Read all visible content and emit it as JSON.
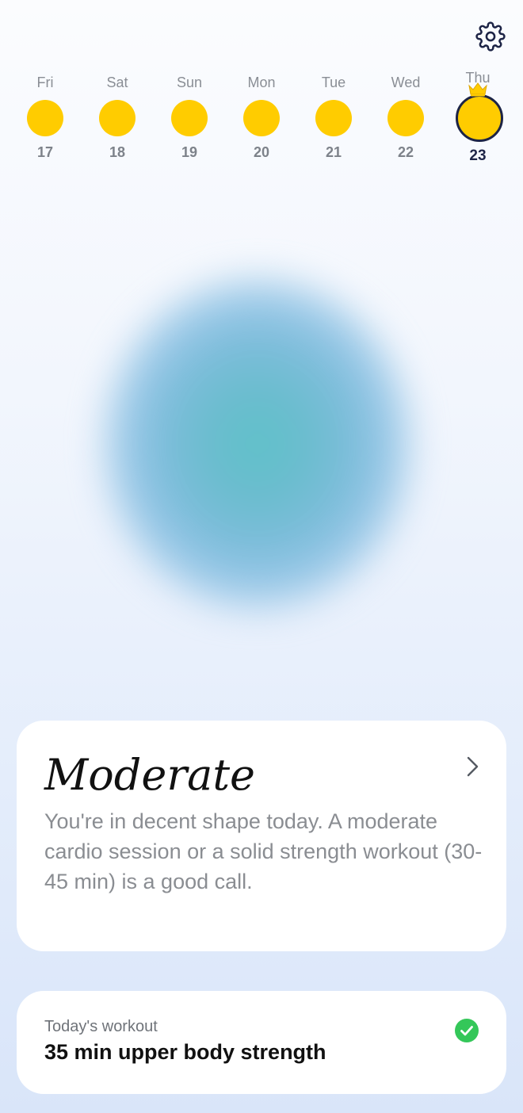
{
  "header": {
    "settings_icon": "gear-icon"
  },
  "week": {
    "days": [
      {
        "name": "Fri",
        "date": "17"
      },
      {
        "name": "Sat",
        "date": "18"
      },
      {
        "name": "Sun",
        "date": "19"
      },
      {
        "name": "Mon",
        "date": "20"
      },
      {
        "name": "Tue",
        "date": "21"
      },
      {
        "name": "Wed",
        "date": "22"
      },
      {
        "name": "Thu",
        "date": "23"
      }
    ],
    "selected_index": 6,
    "day_color": "#ffcc00",
    "selected_ring_color": "#1d2446"
  },
  "status": {
    "title": "Moderate",
    "description": "You're in decent shape today. A moderate cardio session or a solid strength workout (30-45 min) is a good call."
  },
  "workout": {
    "label": "Today's workout",
    "value": "35 min upper body strength",
    "completed": true,
    "check_color": "#34c759"
  }
}
